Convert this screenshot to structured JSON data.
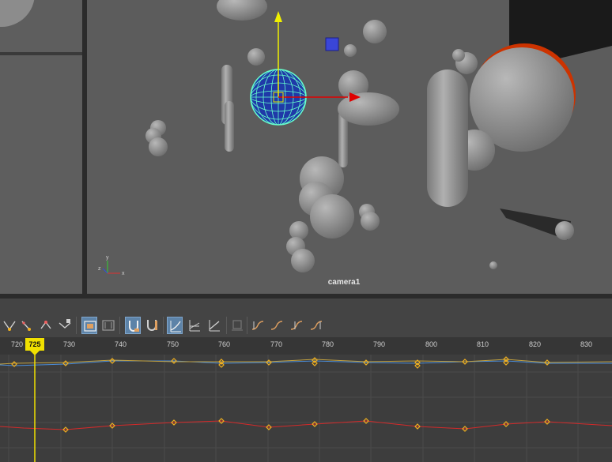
{
  "viewport": {
    "camera_label": "camera1",
    "axis_labels": {
      "x": "x",
      "y": "y",
      "z": "z"
    }
  },
  "graph_editor": {
    "current_frame": "725",
    "frame_ticks": [
      "720",
      "730",
      "740",
      "750",
      "760",
      "770",
      "780",
      "790",
      "800",
      "810",
      "820",
      "830"
    ],
    "curve_colors": {
      "x": "#d42a2a",
      "y": "#4a8cd9",
      "key": "#f0b020",
      "time_marker": "#f0e000"
    }
  },
  "toolbar_icons": [
    "move-nearest-key-icon",
    "insert-key-icon",
    "add-key-icon",
    "lattice-deform-icon",
    "frame-all-icon",
    "frame-playback-range-icon",
    "snap-times-icon",
    "snap-values-icon",
    "spline-tangent-icon",
    "clamped-tangent-icon",
    "linear-tangent-icon",
    "break-tangents-icon",
    "buffer-curve-icon",
    "swap-buffer-icon",
    "plateau-tangent-icon",
    "stepped-tangent-icon"
  ]
}
